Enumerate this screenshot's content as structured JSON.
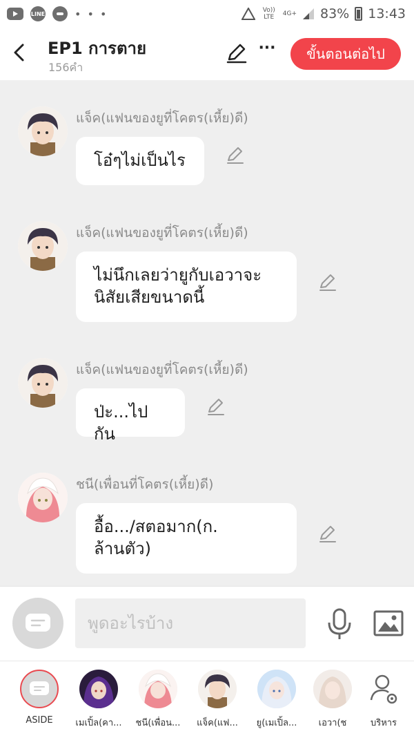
{
  "status_bar": {
    "app_icons": [
      "youtube-icon",
      "line-icon",
      "game-icon"
    ],
    "more": "• • •",
    "volte": "Vo)) LTE",
    "network": "4G+",
    "battery": "83%",
    "time": "13:43"
  },
  "header": {
    "title": "EP1 การตาย",
    "subtitle": "156คำ",
    "next_button": "ขั้นตอนต่อไป",
    "more": "···"
  },
  "messages": [
    {
      "speaker": "แจ็ค(แฟนของยูที่โคตร(เหี้ย)ดี)",
      "text": "โอ๋ๆไม่เป็นไร",
      "avatar": "jack"
    },
    {
      "speaker": "แจ็ค(แฟนของยูที่โคตร(เหี้ย)ดี)",
      "text": "ไม่นึกเลยว่ายูกับเอวาจะ\nนิสัยเสียขนาดนี้",
      "avatar": "jack"
    },
    {
      "speaker": "แจ็ค(แฟนของยูที่โคตร(เหี้ย)ดี)",
      "text": "ป่ะ...ไปกัน",
      "avatar": "jack"
    },
    {
      "speaker": "ชนี(เพื่อนที่โคตร(เหี้ย)ดี)",
      "text": "อื้อ.../สตอมาก(ก.\nล้านตัว)",
      "avatar": "chani"
    }
  ],
  "composer": {
    "placeholder": "พูดอะไรบ้าง"
  },
  "characters": [
    {
      "label": "ASIDE",
      "avatar": "aside"
    },
    {
      "label": "เมเปิ้ล(คา...",
      "avatar": "maple"
    },
    {
      "label": "ชนี(เพื่อน...",
      "avatar": "chani"
    },
    {
      "label": "แจ็ค(แฟ...",
      "avatar": "jack"
    },
    {
      "label": "ยู(เมเปิ้ล...",
      "avatar": "yu"
    },
    {
      "label": "เอวา(ช",
      "avatar": "ava"
    },
    {
      "label": "บริหาร",
      "avatar": "manage-icon"
    }
  ],
  "colors": {
    "accent": "#f2444b",
    "background": "#efefef",
    "bubble": "#ffffff"
  }
}
